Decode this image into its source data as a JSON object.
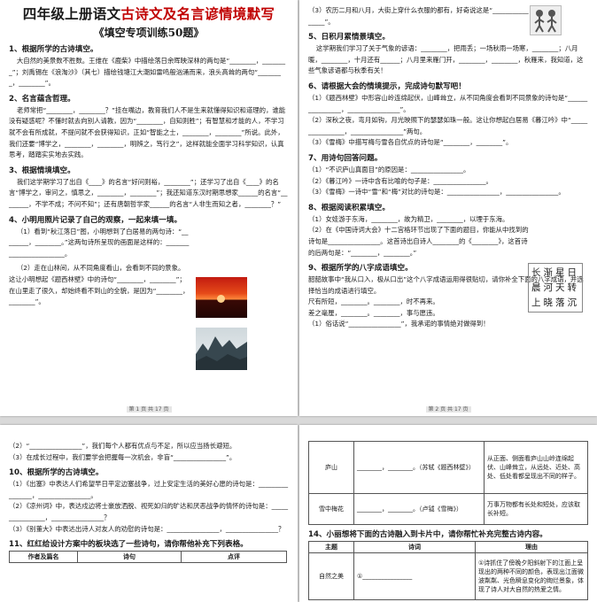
{
  "page1": {
    "title_black": "四年级上册语文",
    "title_red": "古诗文及名言谚情境默写",
    "subtitle": "《填空专项训练50题》",
    "s1_head": "1、根据所学的古诗填空。",
    "s1_text": "大自然的美景数不胜数。王维在《鹿柴》中描绘落日余晖映深林的两句是“________，________”；刘禹锡在《浪淘沙》（其七）描绘钱塘江大潮如雷鸣般汹涌而来，浪头高耸的两句“________，________”。",
    "s2_head": "2、名言蕴含哲理。",
    "s2_text": "老师常把“________，________？”挂在嘴边，教育我们人不是生来就懂得知识和道理的，谁能没有疑惑呢？不懂时就去向别人请教，因为“________，自知则胜”；有智慧和才能的人，不学习就不会有所成就，不提问就不会获得知识，正如“智能之士，________，________”所说。此外，我们还要“博学之，________，________，明辨之，笃行之”，这样就能全面学习科学知识，认真思考，踏踏实实地去实践。",
    "s3_head": "3、根据情境填空。",
    "s3_text": "我们这学期学习了出自《____》的名言“好问则裕，________”；还学习了出自《____》的名言“博学之，审问之，慎思之，________，________”；我还知道东汉时期思想家______的名言“________，不学不成；不问不知”；还有唐朝哲学家______的名言“人非生而知之者，________？”",
    "s4_head": "4、小明用照片记录了自己的观察，一起来填一填。",
    "s4_item1": "（1）看到“秋江落日”图，小明想到了白居易的两句诗：“________，________。”这两句诗所呈现的画面是这样的：________________________。",
    "s4_item2": "（2）走在山林间，从不同角度看山，会看到不同的景象。这让小明想起《题西林壁》中的诗句“________，________”；在山里走了很久，却始终看不到山的全貌，是因为“________，________”。",
    "footer": "第 1 页 共 17 页"
  },
  "page2": {
    "top_text": "（3）农历二月和八月，大街上穿什么衣服的都有，好奇说这是“________________”。",
    "s5_head": "5、日积月累情景填空。",
    "s5_text": "这学期我们学习了关于气象的谚语：________，把雨丢；一场秋雨一场寒，________；八月暖，________，十月还有______；八月里来雁门开，________，________，秋雁来，我知道，这些气象谚语都与秋季有关！",
    "s6_head": "6、请根据大会的情境提示，完成诗句默写吧！",
    "s6_text": "（1）《题西林壁》中形容山岭连绵起伏，山峰耸立，从不同角度会看到不同景象的诗句是“________________，________________”。\n（2）深秋之夜，弯月如钩，月光映照下的瑟瑟如珠一般。这让你想起白居易《暮江吟》中“________________，________________”两句。\n（3）《雪梅》中描写梅与雪各自优点的诗句是“________，________”。",
    "s7_head": "7、用诗句回答问题。",
    "s7_text": "（1）“不识庐山真面目”的原因是：________________。\n（2）《暮江吟》一诗中含有比喻的句子是：________________。\n（3）《雪梅》一诗中“雪”和“梅”对比的诗句是：________________，________________。",
    "s8_head": "8、根据阅读积累填空。",
    "s8_text": "（1）女娃游于东海，________，故为精卫，________，以堙于东海。\n（2）在《中国诗词大会》十二宫格环节出现了下面的题目，你能从中找到的诗句是________________。这首诗出自诗人________的《________》，这首诗的后两句是：“________，________。”",
    "poem_grid": "长渐星日\n晨河天转\n上晓落沉",
    "s9_head": "9、根据所学的八字成语填空。",
    "s9_text": "韶韶故事中“我从口入，极从口出”这个八字成语运用得很贴切，请你补全下面的八字成语，并选择恰当的成语进行填空。\n尺有所短，________。________，时不再来。\n差之毫厘，________。________，事与愿违。\n（1）俗话说“________________”，我承诺的事情绝对做得到！",
    "footer": "第 2 页 共 17 页"
  },
  "page3": {
    "top_text": "（2）“________________”，我们每个人都有优点与不足，所以应当扬长避短。\n（3）在成长过程中，我们要学会把握每一次机会，非盲“________________”。",
    "s10_head": "10、根据所学的古诗填空。",
    "s10_text": "（1）《出塞》中表达人们希望早日平定边塞战争，过上安定生活的美好心愿的诗句是：________________，________________。\n（2）《凉州词》中，表达戍边将士豪放洒脱、视死如归的旷达和厌恶战争的情怀的诗句是：________________，________________？\n（3）《别董大》中表达出诗人对友人的劝慰的诗句是：________________，________________？",
    "s11_head": "11、红红给设计方案中的板块选了一些诗句，请你帮他补充下列表格。",
    "table_headers": [
      "作者及篇名",
      "诗句",
      "点评"
    ]
  },
  "page4": {
    "rows": [
      {
        "name": "庐山",
        "poem": "________，________。（苏轼《题西林壁》）",
        "comment": "从正面、侧面看庐山山岭连绵起伏、山峰耸立，从远处、近处、高处、低处看都呈现出不同的样子。"
      },
      {
        "name": "雪中梅花",
        "poem": "________，________。（卢钺《雪梅》）",
        "comment": "万事万物都有长处和短处，应该取长补短。"
      }
    ],
    "s14_head": "14、小丽想将下面的古诗融入到卡片中，请你帮忙补充完整古诗内容。",
    "table_headers": [
      "主题",
      "诗词",
      "理由"
    ],
    "row_theme": "自然之美",
    "row_poem": "①________________",
    "row_reason": "①诗抓住了傍晚夕阳斜射下的江面上呈现出的两种不同的颜色，表现出江面微波粼粼、光色瞬息变化的绚烂景象，体现了诗人对大自然的热爱之情。"
  }
}
